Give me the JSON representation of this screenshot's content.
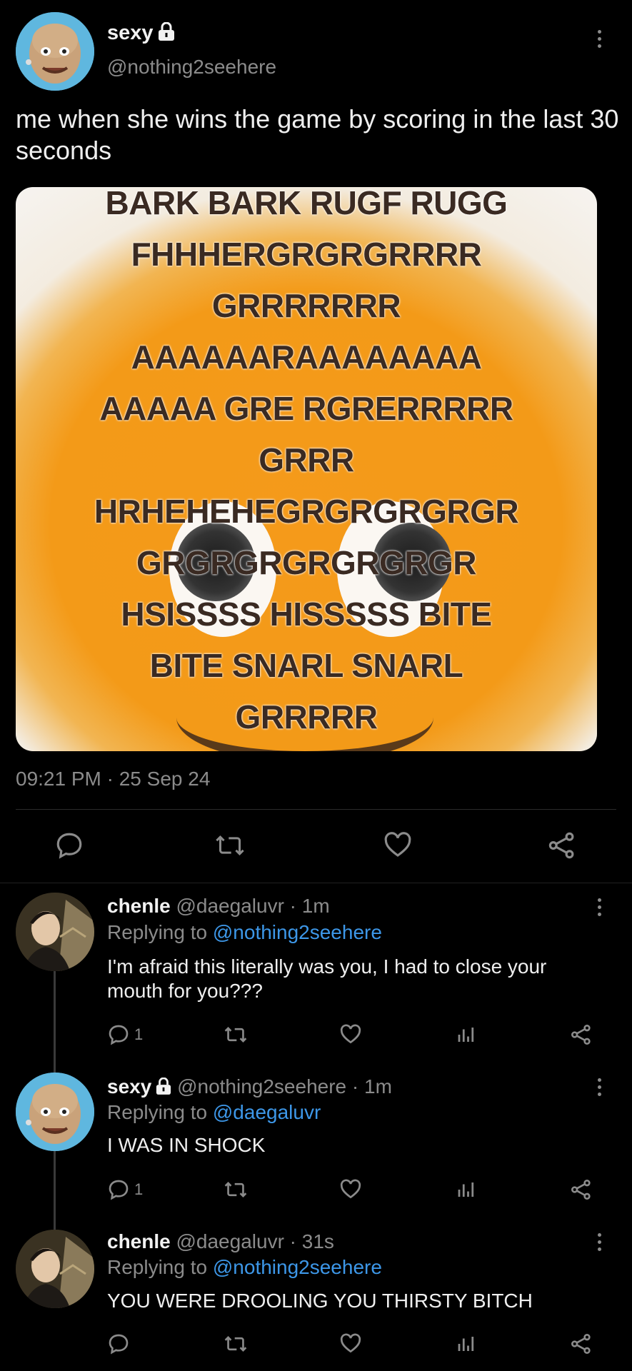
{
  "tweet": {
    "author_name": "sexy",
    "author_handle": "@nothing2seehere",
    "text": "me when she wins the game by scoring in the last 30 seconds",
    "meme_lines": [
      "BARK BARK RUGF RUGG",
      "FHHHERGRGRGRRRR",
      "GRRRRRRR",
      "AAAAAARAAAAAAAA",
      "AAAAA GRE RGRERRRRR",
      "GRRR",
      "HRHEHEHEGRGRGRGRGR",
      "GRGRGRGRGRGRGR",
      "HSISSSS HISSSSS BITE",
      "BITE SNARL SNARL",
      "GRRRRR"
    ],
    "timestamp": "09:21 PM · 25 Sep 24"
  },
  "replies": [
    {
      "name": "chenle",
      "handle": "@daegaluvr",
      "time": "· 1m",
      "replying_label": "Replying to",
      "replying_to": "@nothing2seehere",
      "text": "I'm afraid this literally was you, I had to close your mouth for you???",
      "reply_count": "1"
    },
    {
      "name": "sexy",
      "handle": "@nothing2seehere",
      "time": "· 1m",
      "replying_label": "Replying to",
      "replying_to": "@daegaluvr",
      "text": "I WAS IN SHOCK",
      "reply_count": "1"
    },
    {
      "name": "chenle",
      "handle": "@daegaluvr",
      "time": "· 31s",
      "replying_label": "Replying to",
      "replying_to": "@nothing2seehere",
      "text": "YOU WERE DROOLING YOU THIRSTY BITCH",
      "reply_count": ""
    }
  ],
  "icons": {
    "reply": "reply-icon",
    "retweet": "retweet-icon",
    "like": "heart-icon",
    "share": "share-icon",
    "analytics": "analytics-icon",
    "more": "more-vertical-icon",
    "lock": "lock-icon"
  },
  "colors": {
    "background": "#000000",
    "link": "#3d97e8",
    "muted": "#8b8b8b"
  }
}
